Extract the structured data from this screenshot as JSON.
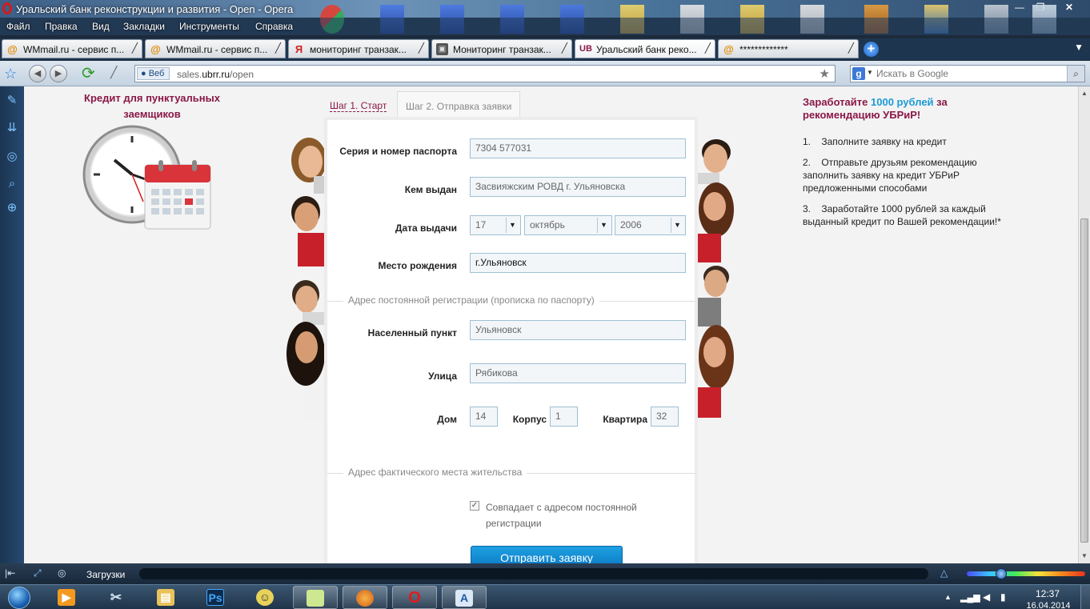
{
  "window": {
    "title": "Уральский банк реконструкции и развития - Open - Opera"
  },
  "menu": [
    "Файл",
    "Правка",
    "Вид",
    "Закладки",
    "Инструменты",
    "Справка"
  ],
  "tabs": [
    {
      "label": "WMmail.ru - сервис п...",
      "icon": "at-icon",
      "active": false
    },
    {
      "label": "WMmail.ru - сервис п...",
      "icon": "at-icon",
      "active": false
    },
    {
      "label": "мониторинг транзак...",
      "icon": "yandex-icon",
      "active": false
    },
    {
      "label": "Мониторинг транзак...",
      "icon": "photo-icon",
      "active": false
    },
    {
      "label": "Уральский банк реко...",
      "icon": "ubrr-icon",
      "active": true
    },
    {
      "label": "*************",
      "icon": "at-icon",
      "active": false
    }
  ],
  "addressbar": {
    "badge": "Веб",
    "url_domain_prefix": "sales.",
    "url_domain": "ubrr.ru",
    "url_path": "/open",
    "search_placeholder": "Искать в Google"
  },
  "page": {
    "promo_left_title": "Кредит для пунктуальных заемщиков",
    "step1": "Шаг 1. Старт",
    "step2": "Шаг 2. Отправка заявки",
    "form": {
      "passport_label": "Серия и номер паспорта",
      "passport_value": "7304 577031",
      "issued_by_label": "Кем выдан",
      "issued_by_value": "Засвияжским РОВД г. Ульяновска",
      "issue_date_label": "Дата выдачи",
      "issue_day": "17",
      "issue_month": "октябрь",
      "issue_year": "2006",
      "birthplace_label": "Место рождения",
      "birthplace_value": "г.Ульяновск",
      "reg_section": "Адрес постоянной регистрации (прописка по паспорту)",
      "locality_label": "Населенный пункт",
      "locality_value": "Ульяновск",
      "street_label": "Улица",
      "street_value": "Рябикова",
      "house_label": "Дом",
      "house_value": "14",
      "building_label": "Корпус",
      "building_value": "1",
      "apartment_label": "Квартира",
      "apartment_value": "32",
      "actual_section": "Адрес фактического места жительства",
      "same_address_label": "Совпадает с адресом постоянной регистрации",
      "submit_label": "Отправить заявку"
    },
    "earn": {
      "title_before": "Заработайте ",
      "title_highlight": "1000 рублей",
      "title_after": " за рекомендацию УБРиР!",
      "items": [
        "1.    Заполните заявку на кредит",
        "2.    Отправьте друзьям рекомендацию заполнить заявку на кредит УБРиР предложенными способами",
        "3.    Заработайте 1000 рублей за каждый выданный кредит по Вашей рекомендации!*"
      ]
    }
  },
  "statusbar": {
    "downloads": "Загрузки"
  },
  "taskbar": {
    "time": "12:37",
    "date": "16.04.2014"
  },
  "colors": {
    "brand": "#8a1847",
    "accent": "#1c9ad6",
    "button": "#0a78c2"
  }
}
